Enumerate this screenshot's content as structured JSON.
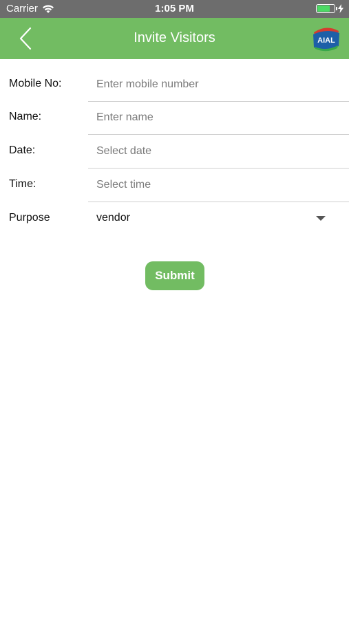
{
  "status_bar": {
    "carrier": "Carrier",
    "time": "1:05 PM",
    "battery_level": 0.75
  },
  "nav": {
    "title": "Invite Visitors",
    "back_icon": "chevron-left-icon",
    "logo_text": "AIAL"
  },
  "form": {
    "mobile": {
      "label": "Mobile No:",
      "placeholder": "Enter mobile number"
    },
    "name": {
      "label": "Name:",
      "placeholder": "Enter name"
    },
    "date": {
      "label": "Date:",
      "placeholder": "Select date"
    },
    "time": {
      "label": "Time:",
      "placeholder": "Select time"
    },
    "purpose": {
      "label": "Purpose",
      "value": "vendor"
    }
  },
  "submit_label": "Submit",
  "colors": {
    "accent": "#72bc62",
    "status_bar": "#6d6d6d"
  }
}
